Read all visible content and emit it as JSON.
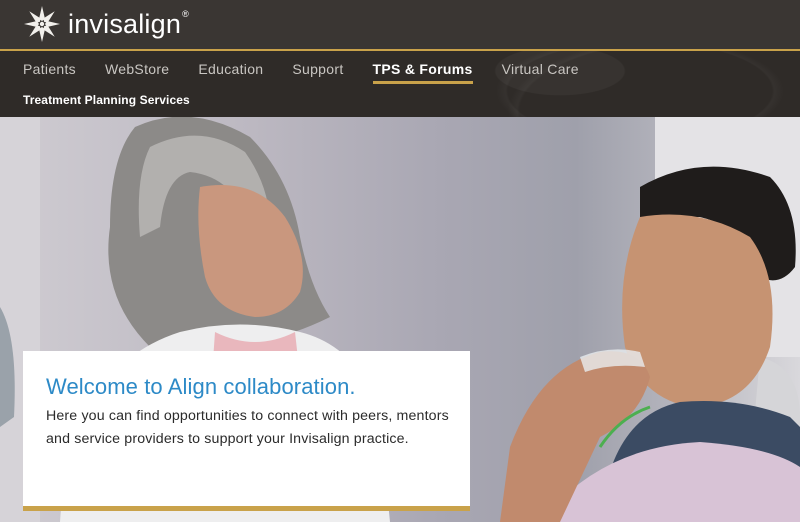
{
  "header": {
    "logo_text": "invisalign",
    "logo_mark": "®"
  },
  "nav": {
    "items": [
      {
        "label": "Patients",
        "active": false
      },
      {
        "label": "WebStore",
        "active": false
      },
      {
        "label": "Education",
        "active": false
      },
      {
        "label": "Support",
        "active": false
      },
      {
        "label": "TPS & Forums",
        "active": true
      },
      {
        "label": "Virtual Care",
        "active": false
      }
    ],
    "sub_item": "Treatment Planning Services"
  },
  "hero": {
    "title": "Welcome to Align collaboration.",
    "body": "Here you can find opportunities to connect with peers, mentors and service providers to support your Invisalign practice."
  },
  "colors": {
    "accent_gold": "#c9a24a",
    "title_blue": "#2d8ac7",
    "header_bg": "#3a3633"
  }
}
